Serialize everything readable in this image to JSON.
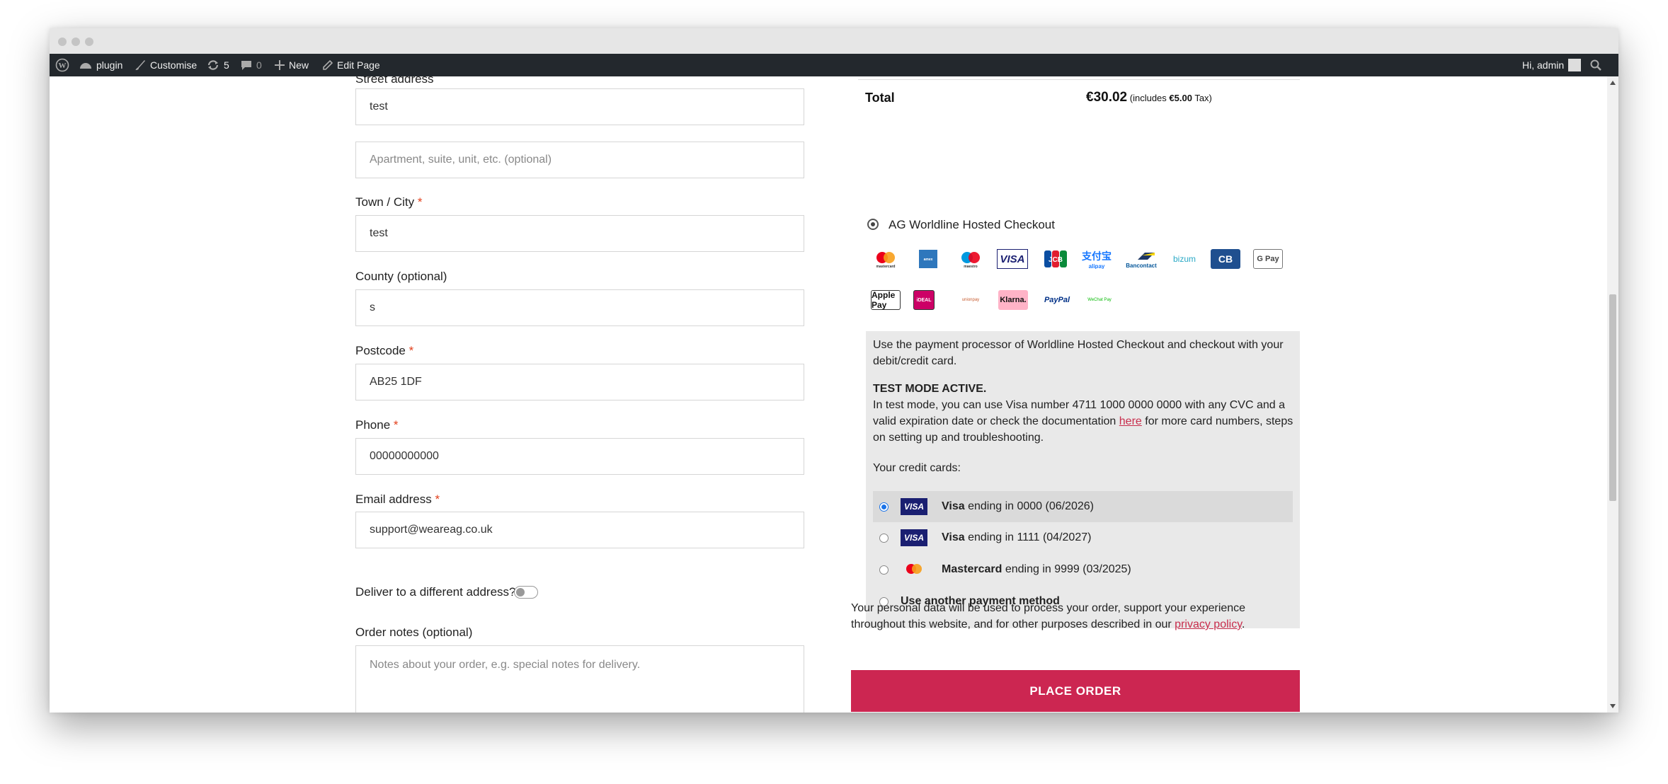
{
  "adminbar": {
    "site_name": "plugin",
    "customise": "Customise",
    "updates_count": "5",
    "comments_count": "0",
    "new_label": "New",
    "edit_page": "Edit Page",
    "greeting": "Hi, admin"
  },
  "billing": {
    "street_label": "Street address",
    "street_value": "test",
    "apartment_placeholder": "Apartment, suite, unit, etc. (optional)",
    "town_label": "Town / City",
    "town_value": "test",
    "county_label": "County (optional)",
    "county_value": "s",
    "postcode_label": "Postcode",
    "postcode_value": "AB25 1DF",
    "phone_label": "Phone",
    "phone_value": "00000000000",
    "email_label": "Email address",
    "email_value": "support@weareag.co.uk",
    "required_marker": "*"
  },
  "shipping": {
    "deliver_label": "Deliver to a different address?",
    "notes_label": "Order notes (optional)",
    "notes_placeholder": "Notes about your order, e.g. special notes for delivery."
  },
  "order": {
    "total_label": "Total",
    "total_value": "€30.02",
    "tax_prefix": "(includes ",
    "tax_value": "€5.00",
    "tax_suffix": " Tax)"
  },
  "payment": {
    "method_name": "AG Worldline Hosted Checkout",
    "logos": [
      "mastercard",
      "amex",
      "maestro",
      "VISA",
      "JCB",
      "alipay",
      "Bancontact",
      "bizum",
      "CB",
      "G Pay",
      "Apple Pay",
      "iDEAL",
      "unionpay",
      "Klarna.",
      "PayPal",
      "WeChat Pay"
    ],
    "description": "Use the payment processor of Worldline Hosted Checkout and checkout with your debit/credit card.",
    "test_mode_title": "TEST MODE ACTIVE.",
    "test_mode_text_1": "In test mode, you can use Visa number 4711 1000 0000 0000 with any CVC and a valid expiration date or check the documentation ",
    "test_mode_link": "here",
    "test_mode_text_2": " for more card numbers, steps on setting up and troubleshooting.",
    "saved_cards_label": "Your credit cards:",
    "cards": [
      {
        "brand": "Visa",
        "detail": "ending in 0000 (06/2026)",
        "selected": true
      },
      {
        "brand": "Visa",
        "detail": "ending in 1111 (04/2027)",
        "selected": false
      },
      {
        "brand": "Mastercard",
        "detail": "ending in 9999 (03/2025)",
        "selected": false
      }
    ],
    "another_method": "Use another payment method"
  },
  "privacy": {
    "text": "Your personal data will be used to process your order, support your experience throughout this website, and for other purposes described in our ",
    "link": "privacy policy",
    "end": "."
  },
  "place_order_label": "PLACE ORDER",
  "colors": {
    "accent": "#cc2651",
    "adminbar": "#23282d",
    "visa": "#1a1f71"
  }
}
